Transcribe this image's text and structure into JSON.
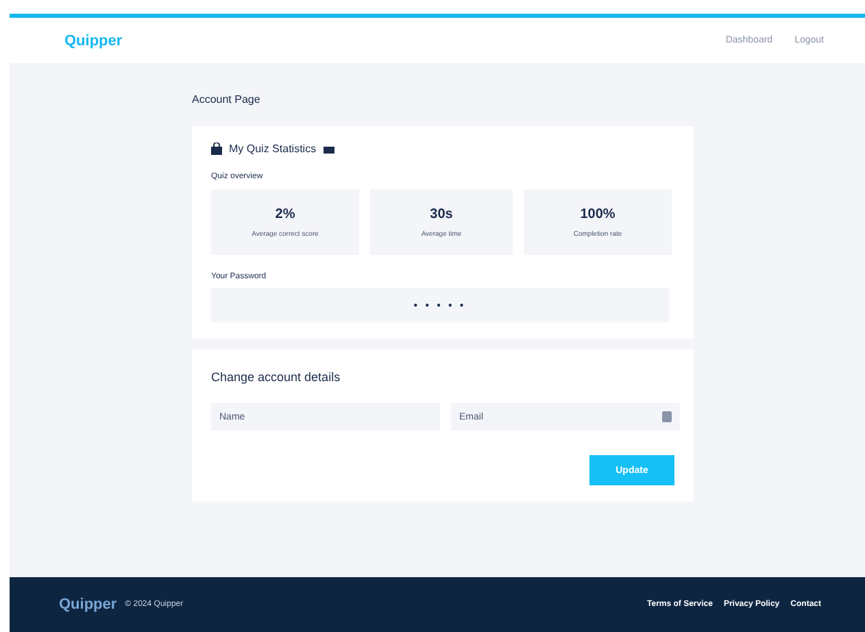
{
  "header": {
    "logo": "Quipper",
    "links": [
      {
        "label": "Dashboard"
      },
      {
        "label": "Logout"
      }
    ]
  },
  "page_title": "Account Page",
  "stats_card": {
    "title": "My Quiz Statistics",
    "subtitle": "Quiz overview",
    "stats": [
      {
        "value": "2%",
        "label": "Average correct score"
      },
      {
        "value": "30s",
        "label": "Average time"
      },
      {
        "value": "100%",
        "label": "Completion rate"
      }
    ],
    "password_label": "Your Password",
    "password_value": "● ● ● ● ●"
  },
  "account_card": {
    "title": "Change account details",
    "fields": [
      {
        "placeholder": "Name",
        "kind": "text"
      },
      {
        "placeholder": "Email",
        "kind": "email"
      }
    ],
    "button": "Update"
  },
  "footer": {
    "logo": "Quipper",
    "copyright": "© 2024 Quipper",
    "links": [
      {
        "label": "Terms of Service"
      },
      {
        "label": "Privacy Policy"
      },
      {
        "label": "Contact"
      }
    ]
  }
}
